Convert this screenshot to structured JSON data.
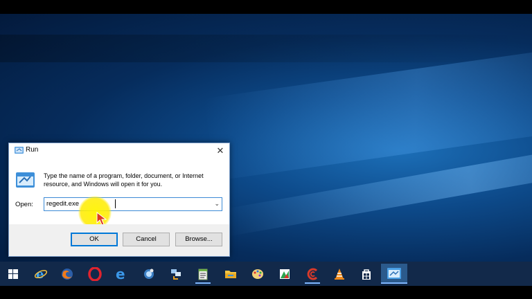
{
  "run_dialog": {
    "title": "Run",
    "close_glyph": "✕",
    "description": "Type the name of a program, folder, document, or Internet resource, and Windows will open it for you.",
    "open_label": "Open:",
    "open_value": "regedit.exe",
    "dropdown_glyph": "⌄",
    "ok_label": "OK",
    "cancel_label": "Cancel",
    "browse_label": "Browse..."
  },
  "taskbar": {
    "items": [
      {
        "name": "start-button",
        "icon": "windows-logo-icon"
      },
      {
        "name": "internet-explorer",
        "icon": "internet-explorer-icon"
      },
      {
        "name": "firefox",
        "icon": "firefox-icon"
      },
      {
        "name": "opera",
        "icon": "opera-icon"
      },
      {
        "name": "edge",
        "icon": "edge-icon"
      },
      {
        "name": "app-globe",
        "icon": "globe-icon"
      },
      {
        "name": "app-network",
        "icon": "network-icon"
      },
      {
        "name": "notepad",
        "icon": "notepad-icon"
      },
      {
        "name": "file-explorer",
        "icon": "folder-icon"
      },
      {
        "name": "paint",
        "icon": "paint-palette-icon"
      },
      {
        "name": "app-photos",
        "icon": "photo-app-icon"
      },
      {
        "name": "ccleaner",
        "icon": "ccleaner-icon"
      },
      {
        "name": "vlc",
        "icon": "vlc-cone-icon"
      },
      {
        "name": "store",
        "icon": "store-bag-icon"
      },
      {
        "name": "run",
        "icon": "run-icon"
      }
    ]
  },
  "colors": {
    "taskbar_bg": "#12294a",
    "accent": "#0078d7",
    "cursor_highlight": "#ffeb00"
  }
}
